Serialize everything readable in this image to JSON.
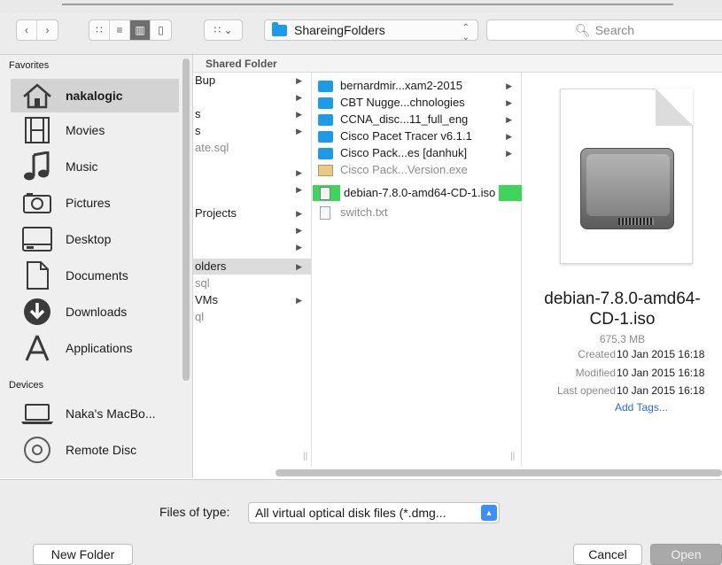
{
  "toolbar": {
    "path_label": "ShareingFolders",
    "search_placeholder": "Search"
  },
  "sidebar": {
    "favorites_heading": "Favorites",
    "devices_heading": "Devices",
    "favorites": [
      {
        "label": "nakalogic",
        "icon": "home-icon",
        "selected": true
      },
      {
        "label": "Movies",
        "icon": "film-icon"
      },
      {
        "label": "Music",
        "icon": "music-note-icon"
      },
      {
        "label": "Pictures",
        "icon": "camera-icon"
      },
      {
        "label": "Desktop",
        "icon": "desktop-icon"
      },
      {
        "label": "Documents",
        "icon": "document-icon"
      },
      {
        "label": "Downloads",
        "icon": "download-icon"
      },
      {
        "label": "Applications",
        "icon": "applications-icon"
      }
    ],
    "devices": [
      {
        "label": "Naka's MacBo...",
        "icon": "laptop-icon"
      },
      {
        "label": "Remote Disc",
        "icon": "disc-icon"
      }
    ]
  },
  "browser": {
    "section_heading": "Shared Folder",
    "column1": [
      {
        "label": "Bup",
        "arrow": true
      },
      {
        "label": "",
        "arrow": true
      },
      {
        "label": "s",
        "arrow": true
      },
      {
        "label": "s",
        "arrow": true
      },
      {
        "label": "ate.sql",
        "arrow": false,
        "grey": true
      },
      {
        "label": "",
        "arrow": true
      },
      {
        "label": "",
        "arrow": true
      },
      {
        "label": "Projects",
        "arrow": true
      },
      {
        "label": "",
        "arrow": true
      },
      {
        "label": "",
        "arrow": true
      },
      {
        "label": "olders",
        "arrow": true,
        "selected": true
      },
      {
        "label": "sql",
        "arrow": false,
        "grey": true
      },
      {
        "label": "VMs",
        "arrow": true
      },
      {
        "label": "ql",
        "arrow": false,
        "grey": true
      }
    ],
    "column2": [
      {
        "label": "bernardmir...xam2-2015",
        "type": "folder",
        "arrow": true
      },
      {
        "label": "CBT Nugge...chnologies",
        "type": "folder",
        "arrow": true
      },
      {
        "label": "CCNA_disc...11_full_eng",
        "type": "folder",
        "arrow": true
      },
      {
        "label": "Cisco Pacet Tracer v6.1.1",
        "type": "folder",
        "arrow": true
      },
      {
        "label": "Cisco Pack...es [danhuk]",
        "type": "folder",
        "arrow": true
      },
      {
        "label": "Cisco Pack...Version.exe",
        "type": "exe",
        "grey": true
      },
      {
        "label": "debian-7.8.0-amd64-CD-1.iso",
        "type": "iso",
        "highlight": true
      },
      {
        "label": "switch.txt",
        "type": "doc",
        "grey": true
      }
    ]
  },
  "preview": {
    "title_line1": "debian-7.8.0-amd64-",
    "title_line2": "CD-1.iso",
    "size": "675,3 MB",
    "created_label": "Created",
    "created_value": "10 Jan 2015 16:18",
    "modified_label": "Modified",
    "modified_value": "10 Jan 2015 16:18",
    "opened_label": "Last opened",
    "opened_value": "10 Jan 2015 16:18",
    "add_tags": "Add Tags..."
  },
  "bottom": {
    "files_of_type_label": "Files of type:",
    "files_of_type_value": "All virtual optical disk files (*.dmg...",
    "new_folder": "New Folder",
    "cancel": "Cancel",
    "open": "Open"
  }
}
